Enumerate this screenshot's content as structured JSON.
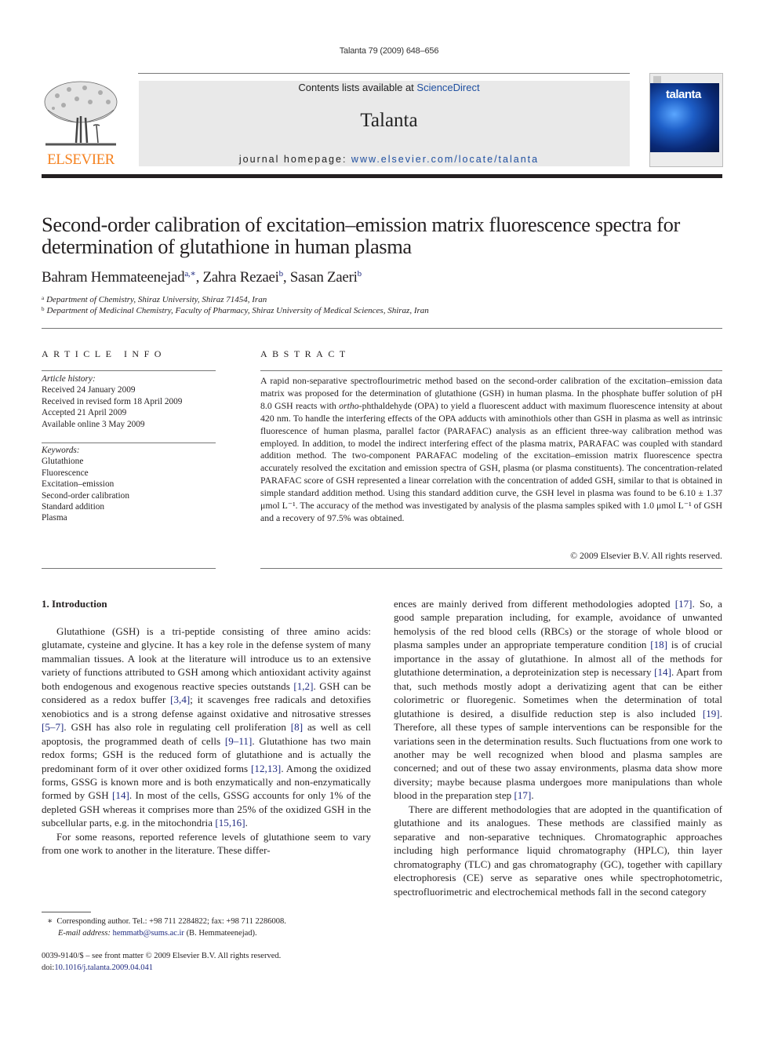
{
  "header": {
    "running_head": "Talanta 79 (2009) 648–656",
    "contents_prefix": "Contents lists available at ",
    "contents_link": "ScienceDirect",
    "journal_name": "Talanta",
    "homepage_prefix": "journal homepage: ",
    "homepage_url": "www.elsevier.com/locate/talanta",
    "publisher_logo_text": "ELSEVIER",
    "cover_title": "talanta",
    "colors": {
      "publisher_orange": "#f58220",
      "link_blue": "#1f4fa0",
      "ref_blue": "#1f2a80"
    }
  },
  "article": {
    "title": "Second-order calibration of excitation–emission matrix fluorescence spectra for determination of glutathione in human plasma",
    "authors": [
      {
        "name": "Bahram Hemmateenejad",
        "sup": "a,∗",
        "sep": ", "
      },
      {
        "name": "Zahra Rezaei",
        "sup": "b",
        "sep": ", "
      },
      {
        "name": "Sasan Zaeri",
        "sup": "b",
        "sep": ""
      }
    ],
    "affiliations": [
      {
        "mark": "a",
        "text": "Department of Chemistry, Shiraz University, Shiraz 71454, Iran"
      },
      {
        "mark": "b",
        "text": "Department of Medicinal Chemistry, Faculty of Pharmacy, Shiraz University of Medical Sciences, Shiraz, Iran"
      }
    ]
  },
  "article_info": {
    "heading": "ARTICLE INFO",
    "history_label": "Article history:",
    "history": [
      "Received 24 January 2009",
      "Received in revised form 18 April 2009",
      "Accepted 21 April 2009",
      "Available online 3 May 2009"
    ],
    "keywords_label": "Keywords:",
    "keywords": [
      "Glutathione",
      "Fluorescence",
      "Excitation–emission",
      "Second-order calibration",
      "Standard addition",
      "Plasma"
    ]
  },
  "abstract": {
    "heading": "ABSTRACT",
    "part1": "A rapid non-separative spectroflourimetric method based on the second-order calibration of the excitation–emission data matrix was proposed for the determination of glutathione (GSH) in human plasma. In the phosphate buffer solution of pH 8.0 GSH reacts with ",
    "italic": "ortho",
    "part2": "-phthaldehyde (OPA) to yield a fluorescent adduct with maximum fluorescence intensity at about 420 nm. To handle the interfering effects of the OPA adducts with aminothiols other than GSH in plasma as well as intrinsic fluorescence of human plasma, parallel factor (PARAFAC) analysis as an efficient three-way calibration method was employed. In addition, to model the indirect interfering effect of the plasma matrix, PARAFAC was coupled with standard addition method. The two-component PARAFAC modeling of the excitation–emission matrix fluorescence spectra accurately resolved the excitation and emission spectra of GSH, plasma (or plasma constituents). The concentration-related PARAFAC score of GSH represented a linear correlation with the concentration of added GSH, similar to that is obtained in simple standard addition method. Using this standard addition curve, the GSH level in plasma was found to be 6.10 ± 1.37 μmol L⁻¹. The accuracy of the method was investigated by analysis of the plasma samples spiked with 1.0 μmol L⁻¹ of GSH and a recovery of 97.5% was obtained.",
    "copyright": "© 2009 Elsevier B.V. All rights reserved."
  },
  "body": {
    "intro_heading": "1.  Introduction",
    "left_paragraphs": [
      [
        {
          "t": "Glutathione (GSH) is a tri-peptide consisting of three amino acids: glutamate, cysteine and glycine. It has a key role in the defense system of many mammalian tissues. A look at the literature will introduce us to an extensive variety of functions attributed to GSH among which antioxidant activity against both endogenous and exogenous reactive species outstands "
        },
        {
          "r": "[1,2]"
        },
        {
          "t": ". GSH can be considered as a redox buffer "
        },
        {
          "r": "[3,4]"
        },
        {
          "t": "; it scavenges free radicals and detoxifies xenobiotics and is a strong defense against oxidative and nitrosative stresses "
        },
        {
          "r": "[5–7]"
        },
        {
          "t": ". GSH has also role in regulating cell proliferation "
        },
        {
          "r": "[8]"
        },
        {
          "t": " as well as cell apoptosis, the programmed death of cells "
        },
        {
          "r": "[9–11]"
        },
        {
          "t": ". Glutathione has two main redox forms; GSH is the reduced form of glutathione and is actually the predominant form of it over other oxidized forms "
        },
        {
          "r": "[12,13]"
        },
        {
          "t": ". Among the oxidized forms, GSSG is known more and is both enzymatically and non-enzymatically formed by GSH "
        },
        {
          "r": "[14]"
        },
        {
          "t": ". In most of the cells, GSSG accounts for only 1% of the depleted GSH whereas it comprises more than 25% of the oxidized GSH in the subcellular parts, e.g. in the mitochondria "
        },
        {
          "r": "[15,16]"
        },
        {
          "t": "."
        }
      ],
      [
        {
          "t": "For some reasons, reported reference levels of glutathione seem to vary from one work to another in the literature. These differ-"
        }
      ]
    ],
    "right_paragraphs": [
      [
        {
          "t": "ences are mainly derived from different methodologies adopted "
        },
        {
          "r": "[17]"
        },
        {
          "t": ". So, a good sample preparation including, for example, avoidance of unwanted hemolysis of the red blood cells (RBCs) or the storage of whole blood or plasma samples under an appropriate temperature condition "
        },
        {
          "r": "[18]"
        },
        {
          "t": " is of crucial importance in the assay of glutathione. In almost all of the methods for glutathione determination, a deproteinization step is necessary "
        },
        {
          "r": "[14]"
        },
        {
          "t": ". Apart from that, such methods mostly adopt a derivatizing agent that can be either colorimetric or fluoregenic. Sometimes when the determination of total glutathione is desired, a disulfide reduction step is also included "
        },
        {
          "r": "[19]"
        },
        {
          "t": ". Therefore, all these types of sample interventions can be responsible for the variations seen in the determination results. Such fluctuations from one work to another may be well recognized when blood and plasma samples are concerned; and out of these two assay environments, plasma data show more diversity; maybe because plasma undergoes more manipulations than whole blood in the preparation step "
        },
        {
          "r": "[17]"
        },
        {
          "t": "."
        }
      ],
      [
        {
          "t": "There are different methodologies that are adopted in the quantification of glutathione and its analogues. These methods are classified mainly as separative and non-separative techniques. Chromatographic approaches including high performance liquid chromatography (HPLC), thin layer chromatography (TLC) and gas chromatography (GC), together with capillary electrophoresis (CE) serve as separative ones while spectrophotometric, spectrofluorimetric and electrochemical methods fall in the second category"
        }
      ]
    ]
  },
  "footnote": {
    "mark": "∗",
    "corresponding": "Corresponding author. Tel.: +98 711 2284822; fax: +98 711 2286008.",
    "email_label": "E-mail address: ",
    "email": "hemmatb@sums.ac.ir",
    "email_suffix": " (B. Hemmateenejad)."
  },
  "front_matter": {
    "issn_line": "0039-9140/$ – see front matter © 2009 Elsevier B.V. All rights reserved.",
    "doi_prefix": "doi:",
    "doi": "10.1016/j.talanta.2009.04.041"
  }
}
